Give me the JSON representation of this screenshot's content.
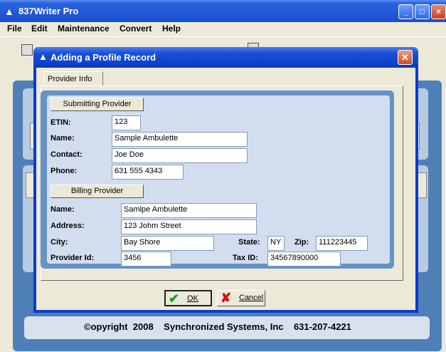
{
  "app": {
    "title": "837Writer Pro",
    "menu": [
      "File",
      "Edit",
      "Maintenance",
      "Convert",
      "Help"
    ],
    "copyright": "©opyright  2008    Synchronized Systems, Inc    631-207-4221"
  },
  "dialog": {
    "title": "Adding a Profile Record",
    "close_label": "✕",
    "tab": "Provider Info",
    "submitting": {
      "section_label": "Submitting Provider",
      "etin_label": "ETIN:",
      "etin": "123",
      "name_label": "Name:",
      "name": "Sample Ambulette",
      "contact_label": "Contact:",
      "contact": "Joe Doe",
      "phone_label": "Phone:",
      "phone": "631 555 4343"
    },
    "billing": {
      "section_label": "Billing Provider",
      "name_label": "Name:",
      "name": "Samlpe Ambulette",
      "address_label": "Address:",
      "address": "123 Johm Street",
      "city_label": "City:",
      "city": "Bay Shore",
      "state_label": "State:",
      "state": "NY",
      "zip_label": "Zip:",
      "zip": "111223445",
      "provider_id_label": "Provider Id:",
      "provider_id": "3456",
      "tax_id_label": "Tax ID:",
      "tax_id": "34567890000"
    },
    "ok_label": "OK",
    "cancel_label": "Cancel"
  },
  "colors": {
    "titlebar": "#2058d6",
    "dialog_frame": "#0a3ad0",
    "panel_outer": "#6593c6",
    "panel_inner": "#d2deef",
    "close": "#d04a25"
  },
  "icons": {
    "app": "wizard-hat-icon",
    "ok": "checkmark-icon",
    "cancel": "red-x-icon"
  }
}
